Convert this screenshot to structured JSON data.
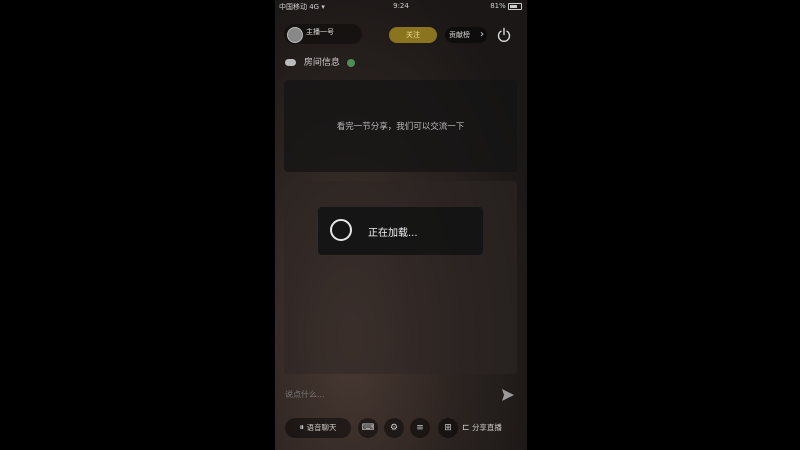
{
  "status_bar": {
    "left": "中国移动 4G ▾",
    "time": "9:24",
    "battery": "81%"
  },
  "header": {
    "user_name": "主播一号",
    "follow_label": "关注",
    "rank_label": "贡献榜"
  },
  "room": {
    "label": "房间信息"
  },
  "notice": {
    "text": "看完一节分享，我们可以交流一下"
  },
  "loading": {
    "text": "正在加载..."
  },
  "chat": {
    "placeholder": "说点什么..."
  },
  "bottom_bar": {
    "voice_label": "语音聊天",
    "share_label": "分享直播"
  },
  "icons": {
    "back": "chevron-right-icon",
    "power": "power-icon",
    "send": "send-icon",
    "gift": "gift-icon"
  }
}
